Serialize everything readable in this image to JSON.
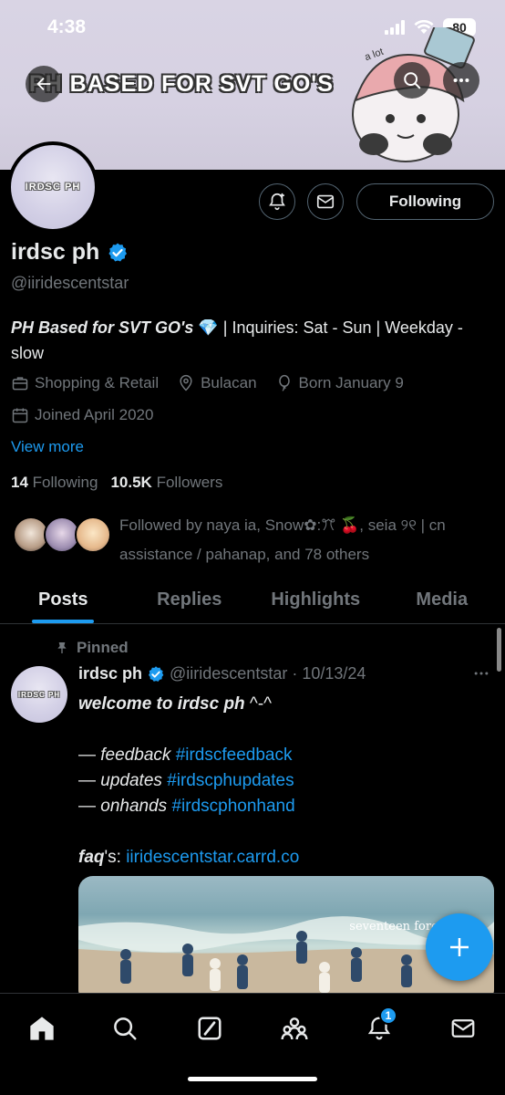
{
  "status_bar": {
    "time": "4:38",
    "battery": "80"
  },
  "banner": {
    "title": "PH BASED FOR SVT GO'S",
    "doodle_text": "a lot"
  },
  "profile": {
    "avatar_text": "IRDSC PH",
    "following_button": "Following",
    "name": "irdsc ph",
    "handle": "@iiridescentstar",
    "bio_bold": "PH Based for SVT GO's",
    "bio_emoji": "💎",
    "bio_rest": " | Inquiries: Sat - Sun | Weekday - slow",
    "category": "Shopping & Retail",
    "location": "Bulacan",
    "birthday": "Born January 9",
    "joined": "Joined April 2020",
    "view_more": "View more",
    "following_count": "14",
    "following_label": "Following",
    "followers_count": "10.5K",
    "followers_label": "Followers",
    "followed_by": "Followed by naya ia, Snow✿:ꔫ 🍒, seia ୨୧ | cn assistance / pahanap, and 78 others"
  },
  "tabs": [
    {
      "label": "Posts"
    },
    {
      "label": "Replies"
    },
    {
      "label": "Highlights"
    },
    {
      "label": "Media"
    }
  ],
  "post": {
    "pinned_label": "Pinned",
    "avatar_text": "IRDSC PH",
    "name": "irdsc ph",
    "handle": "@iiridescentstar",
    "dot": "·",
    "date": "10/13/24",
    "line1_bold": "welcome to irdsc ph",
    "line1_rest": " ^-^",
    "line2_prefix": "— ",
    "line2_it": "feedback",
    "line2_tag": "#irdscfeedback",
    "line3_prefix": "— ",
    "line3_it": "updates",
    "line3_tag": "#irdscphupdates",
    "line4_prefix": "— ",
    "line4_it": "onhands",
    "line4_tag": "#irdscphonhand",
    "faq_bold": "faq",
    "faq_rest": "'s: ",
    "faq_link": "iiridescentstar.carrd.co",
    "media_caption": "seventeen forever"
  },
  "bottom_nav": {
    "notification_badge": "1"
  },
  "colors": {
    "accent": "#1d9bf0",
    "background": "#000000",
    "muted": "#71767b"
  }
}
